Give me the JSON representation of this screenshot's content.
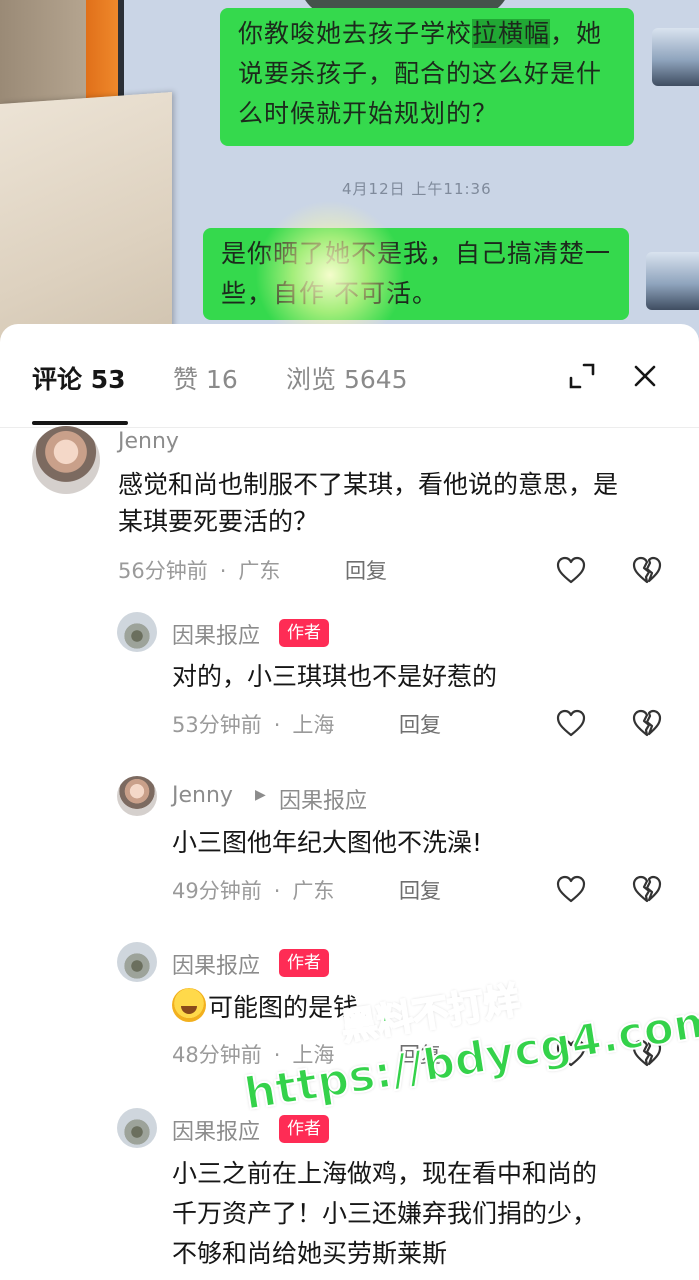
{
  "video": {
    "bubble_1_before": "你教唆她去孩子学校",
    "bubble_1_highlight": "拉横幅",
    "bubble_1_after": "，她说要杀孩子，配合的这么好是什么时候就开始规划的？",
    "timestamp": "4月12日 上午11:36",
    "bubble_2": "是你晒了她不是我，自己搞清楚一些，自作   不可活。"
  },
  "tabs": {
    "comments_label": "评论",
    "comments_count": "53",
    "likes_label": "赞",
    "likes_count": "16",
    "views_label": "浏览",
    "views_count": "5645"
  },
  "comments": [
    {
      "author": "Jenny",
      "text": "感觉和尚也制服不了某琪，看他说的意思，是某琪要死要活的？",
      "time": "56分钟前",
      "location": "广东",
      "reply_label": "回复"
    },
    {
      "author": "因果报应",
      "badge": "作者",
      "text": "对的，小三琪琪也不是好惹的",
      "time": "53分钟前",
      "location": "上海",
      "reply_label": "回复"
    },
    {
      "author": "Jenny",
      "reply_to": "因果报应",
      "text": "小三图他年纪大图他不洗澡!",
      "time": "49分钟前",
      "location": "广东",
      "reply_label": "回复"
    },
    {
      "author": "因果报应",
      "badge": "作者",
      "text": "可能图的是钱",
      "time": "48分钟前",
      "location": "上海",
      "reply_label": "回复"
    },
    {
      "author": "因果报应",
      "badge": "作者",
      "text_line1": "小三之前在上海做鸡，现在看中和尚的",
      "text_line2": "千万资产了！小三还嫌弃我们捐的少，",
      "text_line3": "不够和尚给她买劳斯莱斯"
    }
  ],
  "watermark": {
    "line1": "黑料不打烊",
    "line2": "https://bdycg4.com"
  },
  "colors": {
    "accent_badge": "#fe2c55",
    "chat_bubble": "#35d94d",
    "watermark": "#34d24a"
  }
}
